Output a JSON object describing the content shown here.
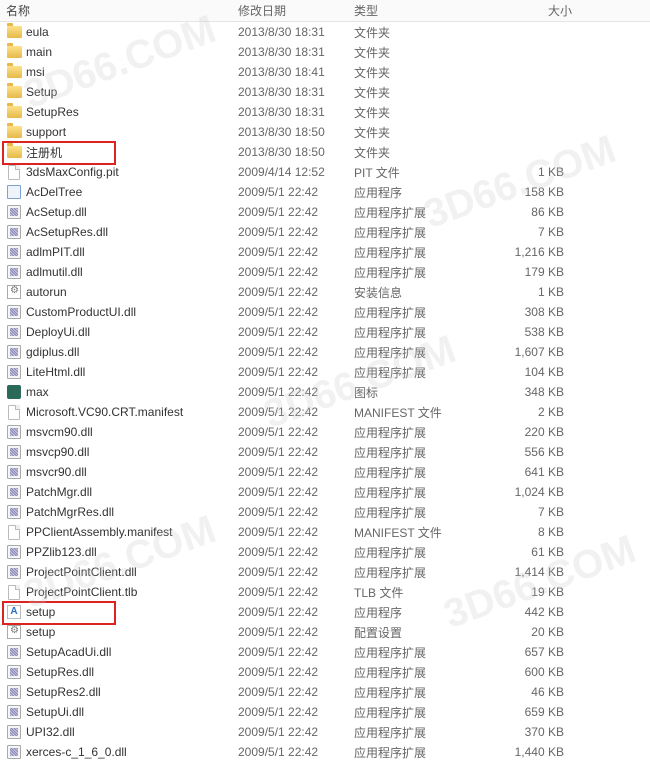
{
  "columns": {
    "name": "名称",
    "date": "修改日期",
    "type": "类型",
    "size": "大小"
  },
  "watermark": "3D66.COM",
  "files": [
    {
      "icon": "folder",
      "name": "eula",
      "date": "2013/8/30 18:31",
      "type": "文件夹",
      "size": ""
    },
    {
      "icon": "folder",
      "name": "main",
      "date": "2013/8/30 18:31",
      "type": "文件夹",
      "size": ""
    },
    {
      "icon": "folder",
      "name": "msi",
      "date": "2013/8/30 18:41",
      "type": "文件夹",
      "size": ""
    },
    {
      "icon": "folder",
      "name": "Setup",
      "date": "2013/8/30 18:31",
      "type": "文件夹",
      "size": ""
    },
    {
      "icon": "folder",
      "name": "SetupRes",
      "date": "2013/8/30 18:31",
      "type": "文件夹",
      "size": ""
    },
    {
      "icon": "folder",
      "name": "support",
      "date": "2013/8/30 18:50",
      "type": "文件夹",
      "size": ""
    },
    {
      "icon": "folder",
      "name": "注册机",
      "date": "2013/8/30 18:50",
      "type": "文件夹",
      "size": "",
      "highlight": true
    },
    {
      "icon": "file",
      "name": "3dsMaxConfig.pit",
      "date": "2009/4/14 12:52",
      "type": "PIT 文件",
      "size": "1 KB"
    },
    {
      "icon": "exe",
      "name": "AcDelTree",
      "date": "2009/5/1 22:42",
      "type": "应用程序",
      "size": "158 KB"
    },
    {
      "icon": "dll",
      "name": "AcSetup.dll",
      "date": "2009/5/1 22:42",
      "type": "应用程序扩展",
      "size": "86 KB"
    },
    {
      "icon": "dll",
      "name": "AcSetupRes.dll",
      "date": "2009/5/1 22:42",
      "type": "应用程序扩展",
      "size": "7 KB"
    },
    {
      "icon": "dll",
      "name": "adlmPIT.dll",
      "date": "2009/5/1 22:42",
      "type": "应用程序扩展",
      "size": "1,216 KB"
    },
    {
      "icon": "dll",
      "name": "adlmutil.dll",
      "date": "2009/5/1 22:42",
      "type": "应用程序扩展",
      "size": "179 KB"
    },
    {
      "icon": "config",
      "name": "autorun",
      "date": "2009/5/1 22:42",
      "type": "安装信息",
      "size": "1 KB"
    },
    {
      "icon": "dll",
      "name": "CustomProductUI.dll",
      "date": "2009/5/1 22:42",
      "type": "应用程序扩展",
      "size": "308 KB"
    },
    {
      "icon": "dll",
      "name": "DeployUi.dll",
      "date": "2009/5/1 22:42",
      "type": "应用程序扩展",
      "size": "538 KB"
    },
    {
      "icon": "dll",
      "name": "gdiplus.dll",
      "date": "2009/5/1 22:42",
      "type": "应用程序扩展",
      "size": "1,607 KB"
    },
    {
      "icon": "dll",
      "name": "LiteHtml.dll",
      "date": "2009/5/1 22:42",
      "type": "应用程序扩展",
      "size": "104 KB"
    },
    {
      "icon": "max",
      "name": "max",
      "date": "2009/5/1 22:42",
      "type": "图标",
      "size": "348 KB"
    },
    {
      "icon": "file",
      "name": "Microsoft.VC90.CRT.manifest",
      "date": "2009/5/1 22:42",
      "type": "MANIFEST 文件",
      "size": "2 KB"
    },
    {
      "icon": "dll",
      "name": "msvcm90.dll",
      "date": "2009/5/1 22:42",
      "type": "应用程序扩展",
      "size": "220 KB"
    },
    {
      "icon": "dll",
      "name": "msvcp90.dll",
      "date": "2009/5/1 22:42",
      "type": "应用程序扩展",
      "size": "556 KB"
    },
    {
      "icon": "dll",
      "name": "msvcr90.dll",
      "date": "2009/5/1 22:42",
      "type": "应用程序扩展",
      "size": "641 KB"
    },
    {
      "icon": "dll",
      "name": "PatchMgr.dll",
      "date": "2009/5/1 22:42",
      "type": "应用程序扩展",
      "size": "1,024 KB"
    },
    {
      "icon": "dll",
      "name": "PatchMgrRes.dll",
      "date": "2009/5/1 22:42",
      "type": "应用程序扩展",
      "size": "7 KB"
    },
    {
      "icon": "file",
      "name": "PPClientAssembly.manifest",
      "date": "2009/5/1 22:42",
      "type": "MANIFEST 文件",
      "size": "8 KB"
    },
    {
      "icon": "dll",
      "name": "PPZlib123.dll",
      "date": "2009/5/1 22:42",
      "type": "应用程序扩展",
      "size": "61 KB"
    },
    {
      "icon": "dll",
      "name": "ProjectPointClient.dll",
      "date": "2009/5/1 22:42",
      "type": "应用程序扩展",
      "size": "1,414 KB"
    },
    {
      "icon": "file",
      "name": "ProjectPointClient.tlb",
      "date": "2009/5/1 22:42",
      "type": "TLB 文件",
      "size": "19 KB"
    },
    {
      "icon": "bluea",
      "name": "setup",
      "date": "2009/5/1 22:42",
      "type": "应用程序",
      "size": "442 KB",
      "highlight": true
    },
    {
      "icon": "config",
      "name": "setup",
      "date": "2009/5/1 22:42",
      "type": "配置设置",
      "size": "20 KB"
    },
    {
      "icon": "dll",
      "name": "SetupAcadUi.dll",
      "date": "2009/5/1 22:42",
      "type": "应用程序扩展",
      "size": "657 KB"
    },
    {
      "icon": "dll",
      "name": "SetupRes.dll",
      "date": "2009/5/1 22:42",
      "type": "应用程序扩展",
      "size": "600 KB"
    },
    {
      "icon": "dll",
      "name": "SetupRes2.dll",
      "date": "2009/5/1 22:42",
      "type": "应用程序扩展",
      "size": "46 KB"
    },
    {
      "icon": "dll",
      "name": "SetupUi.dll",
      "date": "2009/5/1 22:42",
      "type": "应用程序扩展",
      "size": "659 KB"
    },
    {
      "icon": "dll",
      "name": "UPI32.dll",
      "date": "2009/5/1 22:42",
      "type": "应用程序扩展",
      "size": "370 KB"
    },
    {
      "icon": "dll",
      "name": "xerces-c_1_6_0.dll",
      "date": "2009/5/1 22:42",
      "type": "应用程序扩展",
      "size": "1,440 KB"
    }
  ]
}
